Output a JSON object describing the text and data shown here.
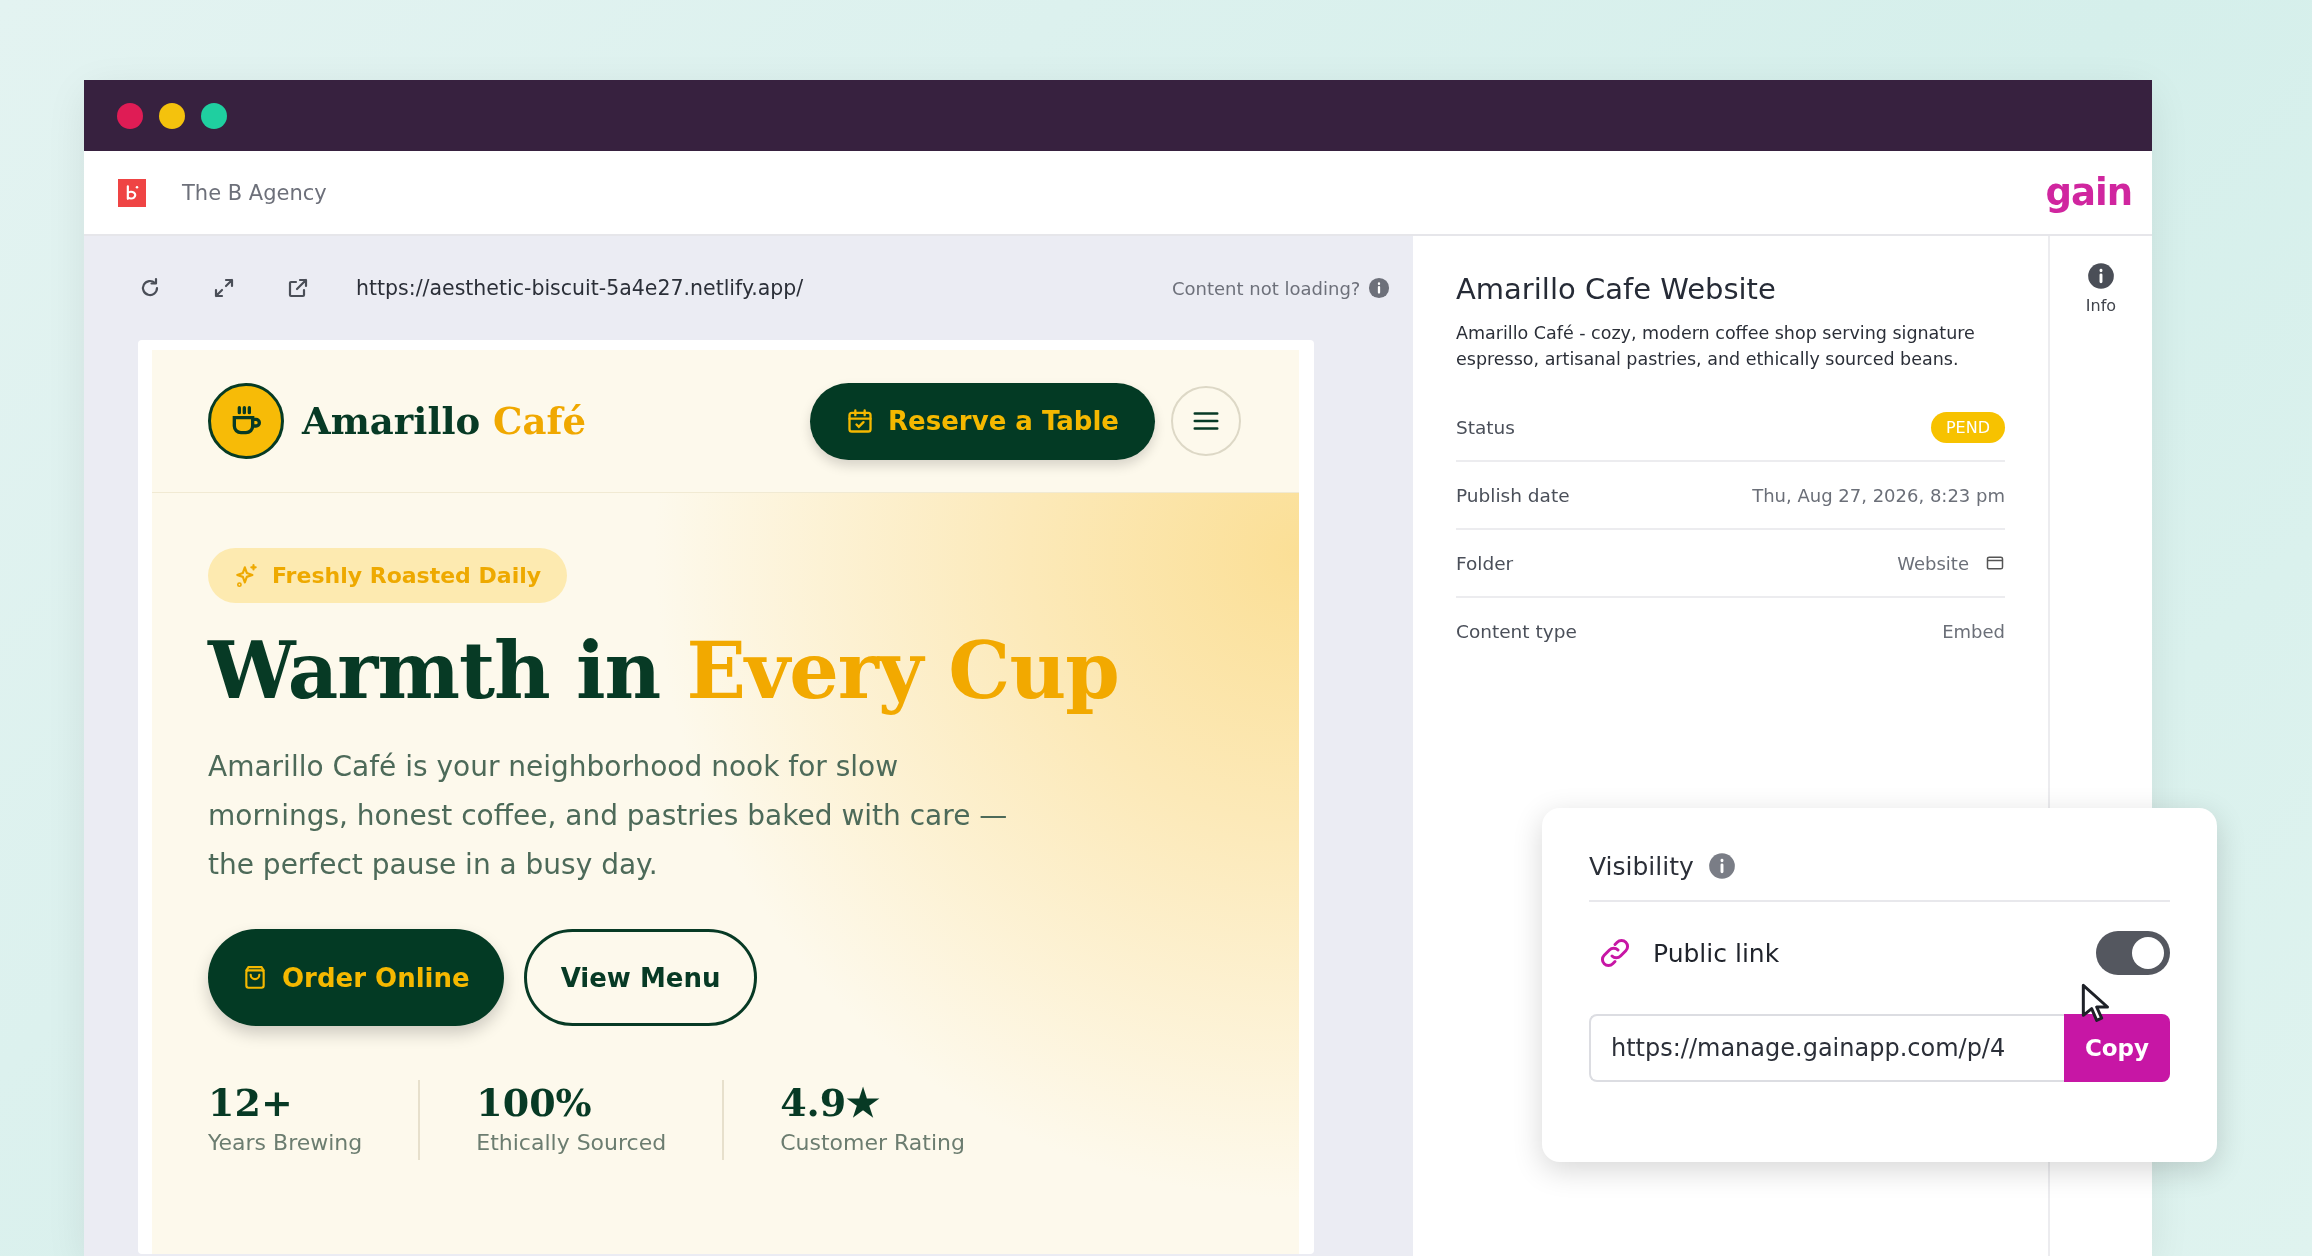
{
  "workspace": {
    "name": "The B Agency",
    "brand": "gain"
  },
  "preview_toolbar": {
    "url": "https://aesthetic-biscuit-5a4e27.netlify.app/",
    "help": "Content not loading?"
  },
  "site": {
    "brand_name": "Amarillo",
    "brand_accent": "Café",
    "cta": "Reserve a Table",
    "badge": "Freshly Roasted Daily",
    "headline": "Warmth in",
    "headline_accent": "Every Cup",
    "intro": "Amarillo Café is your neighborhood nook for slow mornings, honest coffee, and pastries baked with care — the perfect pause in a busy day.",
    "buttons": [
      {
        "label": "Order Online",
        "kind": "primary"
      },
      {
        "label": "View Menu",
        "kind": "secondary"
      }
    ],
    "stats": [
      {
        "value": "12+",
        "label": "Years Brewing"
      },
      {
        "value": "100%",
        "label": "Ethically Sourced"
      },
      {
        "value": "4.9★",
        "label": "Customer Rating"
      }
    ]
  },
  "details": {
    "title": "Amarillo Cafe Website",
    "description": "Amarillo Café - cozy, modern coffee shop serving signature espresso, artisanal pastries, and ethically sourced beans.",
    "fields": [
      {
        "label": "Status",
        "value": "PEND",
        "kind": "badge"
      },
      {
        "label": "Publish date",
        "value": "Thu, Aug 27, 2026, 8:23 pm",
        "kind": "text"
      },
      {
        "label": "Folder",
        "value": "Website",
        "kind": "folder"
      },
      {
        "label": "Content type",
        "value": "Embed",
        "kind": "text"
      }
    ]
  },
  "side_tabs": [
    {
      "label": "Info"
    }
  ],
  "visibility": {
    "title": "Visibility",
    "public_link": {
      "label": "Public link",
      "on": true
    },
    "url": "https://manage.gainapp.com/p/4",
    "copy": "Copy"
  }
}
